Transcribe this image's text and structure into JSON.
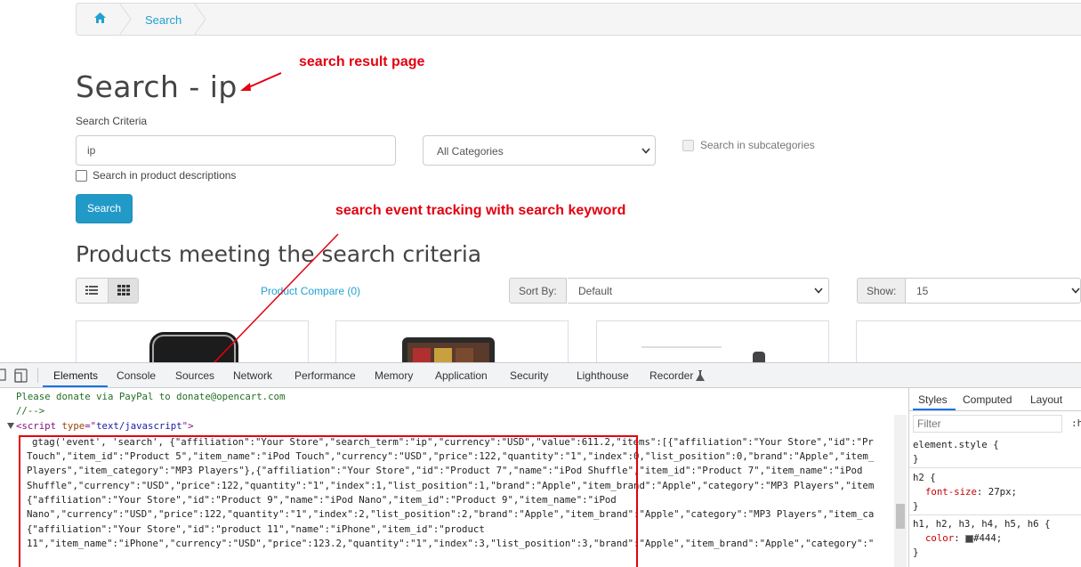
{
  "breadcrumb": {
    "current": "Search"
  },
  "annotations": {
    "result_page": "search result page",
    "event_tracking": "search event tracking with search keyword"
  },
  "page": {
    "title": "Search - ip",
    "criteria_label": "Search Criteria",
    "search_value": "ip",
    "category_selected": "All Categories",
    "subcategories_label": "Search in subcategories",
    "descriptions_label": "Search in product descriptions",
    "search_button": "Search",
    "products_heading": "Products meeting the search criteria",
    "compare_link": "Product Compare (0)",
    "sort_label": "Sort By:",
    "sort_value": "Default",
    "show_label": "Show:",
    "show_value": "15"
  },
  "devtools": {
    "tabs": [
      "Elements",
      "Console",
      "Sources",
      "Network",
      "Performance",
      "Memory",
      "Application",
      "Security",
      "Lighthouse",
      "Recorder"
    ],
    "active_tab": "Elements",
    "lines": {
      "l1": "Please donate via PayPal to donate@opencart.com",
      "l2": "//-->",
      "tag_open": "<script ",
      "tag_attr": "type",
      "tag_eq": "=\"",
      "tag_val": "text/javascript",
      "tag_close": "\">",
      "c1": "gtag('event', 'search', {\"affiliation\":\"Your Store\",\"search_term\":\"ip\",\"currency\":\"USD\",\"value\":611.2,\"items\":[{\"affiliation\":\"Your Store\",\"id\":\"Pr",
      "c2": "Touch\",\"item_id\":\"Product 5\",\"item_name\":\"iPod Touch\",\"currency\":\"USD\",\"price\":122,\"quantity\":\"1\",\"index\":0,\"list_position\":0,\"brand\":\"Apple\",\"item_",
      "c3": "Players\",\"item_category\":\"MP3 Players\"},{\"affiliation\":\"Your Store\",\"id\":\"Product 7\",\"name\":\"iPod Shuffle\",\"item_id\":\"Product 7\",\"item_name\":\"iPod",
      "c4": "Shuffle\",\"currency\":\"USD\",\"price\":122,\"quantity\":\"1\",\"index\":1,\"list_position\":1,\"brand\":\"Apple\",\"item_brand\":\"Apple\",\"category\":\"MP3 Players\",\"item",
      "c5": "{\"affiliation\":\"Your Store\",\"id\":\"Product 9\",\"name\":\"iPod Nano\",\"item_id\":\"Product 9\",\"item_name\":\"iPod",
      "c6": "Nano\",\"currency\":\"USD\",\"price\":122,\"quantity\":\"1\",\"index\":2,\"list_position\":2,\"brand\":\"Apple\",\"item_brand\":\"Apple\",\"category\":\"MP3 Players\",\"item_ca",
      "c7": "{\"affiliation\":\"Your Store\",\"id\":\"product 11\",\"name\":\"iPhone\",\"item_id\":\"product",
      "c8": "11\",\"item_name\":\"iPhone\",\"currency\":\"USD\",\"price\":123.2,\"quantity\":\"1\",\"index\":3,\"list_position\":3,\"brand\":\"Apple\",\"item_brand\":\"Apple\",\"category\":\""
    },
    "styles_tabs": [
      "Styles",
      "Computed",
      "Layout"
    ],
    "filter_placeholder": "Filter",
    "hov": ":h",
    "rules": {
      "r1": "element.style {",
      "r1_close": "}",
      "r2": "h2 {",
      "r2_prop": "font-size",
      "r2_val": ": 27px;",
      "r2_close": "}",
      "r3": "h1, h2, h3, h4, h5, h6 {",
      "r3_prop": "color",
      "r3_val": "#444;",
      "r3_close": "}"
    }
  },
  "colors": {
    "annotation": "#e3000f",
    "link": "#23a1d1",
    "button": "#229ac8",
    "text": "#444444"
  }
}
